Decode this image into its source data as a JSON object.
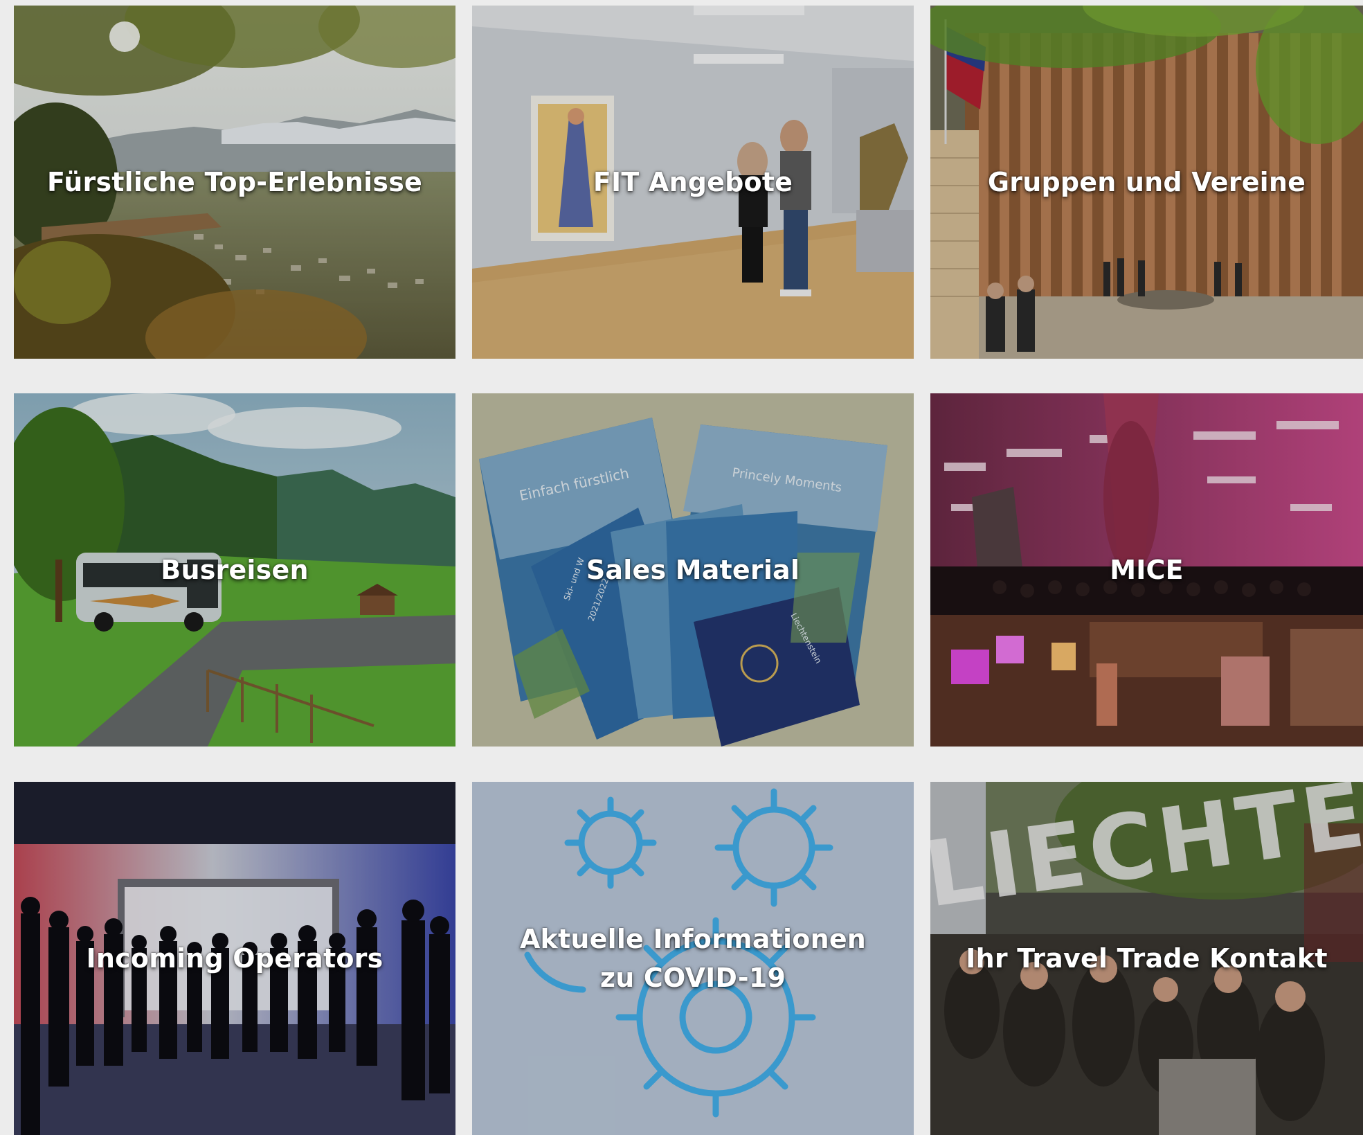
{
  "tiles": [
    {
      "label": "Fürstliche Top-Erlebnisse",
      "scene": "landscape-view"
    },
    {
      "label": "FIT Angebote",
      "scene": "art-gallery"
    },
    {
      "label": "Gruppen und Vereine",
      "scene": "parliament-building"
    },
    {
      "label": "Busreisen",
      "scene": "bus-in-mountains"
    },
    {
      "label": "Sales Material",
      "scene": "brochures"
    },
    {
      "label": "MICE",
      "scene": "event-hall"
    },
    {
      "label": "Incoming Operators",
      "scene": "silhouette-crowd"
    },
    {
      "label": "Aktuelle Informationen zu COVID-19",
      "scene": "virus-illustration"
    },
    {
      "label": "Ihr Travel Trade Kontakt",
      "scene": "street-festival"
    }
  ],
  "brochures": {
    "b1": "Einfach fürstlich",
    "b2": "Princely Moments",
    "b3": "Ski- und W",
    "b4": "2021/2022",
    "b5": "Liechtenstein"
  },
  "festival_sign": "LIECHTENSTEIN"
}
